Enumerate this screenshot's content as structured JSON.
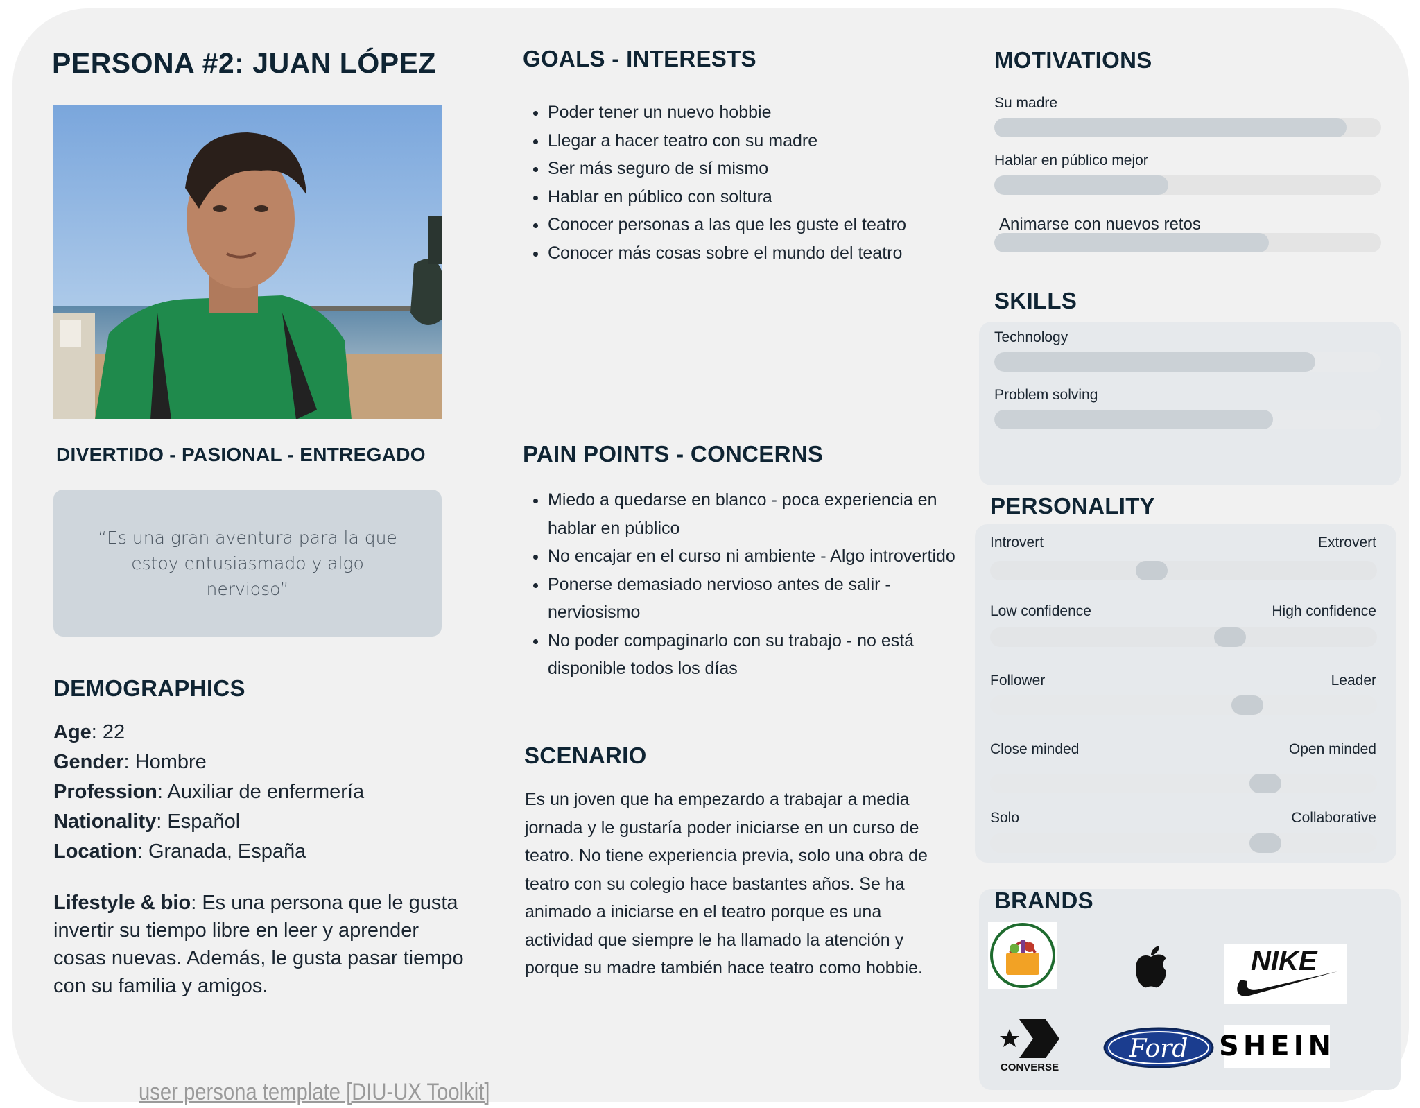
{
  "persona": {
    "title": "PERSONA #2: JUAN LÓPEZ",
    "traits": "DIVERTIDO - PASIONAL - ENTREGADO",
    "quote": "“Es una gran aventura para la que estoy entusiasmado y algo nervioso”"
  },
  "demographics": {
    "heading": "DEMOGRAPHICS",
    "items": [
      {
        "label": "Age",
        "value": ": 22"
      },
      {
        "label": "Gender",
        "value": ": Hombre"
      },
      {
        "label": "Profession",
        "value": ": Auxiliar de enfermería"
      },
      {
        "label": "Nationality",
        "value": ": Español"
      },
      {
        "label": "Location",
        "value": ": Granada, España"
      }
    ],
    "bio_label": "Lifestyle & bio",
    "bio_text": ": Es una persona que le gusta invertir su tiempo libre en leer y aprender cosas nuevas. Además, le gusta pasar tiempo con su familia y amigos."
  },
  "goals": {
    "heading": "GOALS - INTERESTS",
    "items": [
      "Poder tener un nuevo hobbie",
      "Llegar a hacer teatro con su madre",
      "Ser más seguro de sí mismo",
      "Hablar en público con soltura",
      "Conocer personas a las que les guste el teatro",
      "Conocer más cosas sobre el mundo del teatro"
    ]
  },
  "pain_points": {
    "heading": "PAIN POINTS - CONCERNS",
    "items": [
      "Miedo a quedarse en blanco - poca experiencia en hablar en público",
      "No encajar en el curso ni ambiente - Algo introvertido",
      "Ponerse demasiado nervioso antes de salir - nerviosismo",
      "No poder compaginarlo con su trabajo - no está disponible todos los días"
    ]
  },
  "scenario": {
    "heading": "SCENARIO",
    "text": "Es un joven que ha empezardo a trabajar a media jornada y le gustaría poder iniciarse en un curso de teatro. No tiene experiencia previa, solo una obra de teatro con su colegio hace bastantes años. Se ha animado a iniciarse en el teatro porque es una actividad que siempre le ha llamado la atención y porque su madre también hace teatro como hobbie."
  },
  "motivations": {
    "heading": "MOTIVATIONS",
    "items": [
      {
        "label": "Su madre",
        "level": 0.91
      },
      {
        "label": "Hablar en público mejor",
        "level": 0.45
      },
      {
        "label": "Animarse con nuevos retos",
        "level": 0.71
      }
    ]
  },
  "skills": {
    "heading": "SKILLS",
    "items": [
      {
        "label": "Technology",
        "level": 0.83
      },
      {
        "label": "Problem solving",
        "level": 0.72
      }
    ]
  },
  "personality": {
    "heading": "PERSONALITY",
    "items": [
      {
        "left": "Introvert",
        "right": "Extrovert",
        "position": 0.41
      },
      {
        "left": "Low confidence",
        "right": "High confidence",
        "position": 0.63
      },
      {
        "left": "Follower",
        "right": "Leader",
        "position": 0.68
      },
      {
        "left": "Close minded",
        "right": "Open minded",
        "position": 0.73
      },
      {
        "left": "Solo",
        "right": "Collaborative",
        "position": 0.73
      }
    ]
  },
  "brands": {
    "heading": "BRANDS",
    "logos": [
      "grocery-basket-logo",
      "apple-logo",
      "nike-logo",
      "converse-logo",
      "ford-logo",
      "shein-logo"
    ],
    "nike_text": "NIKE",
    "converse_text": "CONVERSE",
    "ford_text": "Ford",
    "shein_text": "SHEIN"
  },
  "footer": {
    "link": "user persona template [DIU-UX Toolkit]"
  }
}
